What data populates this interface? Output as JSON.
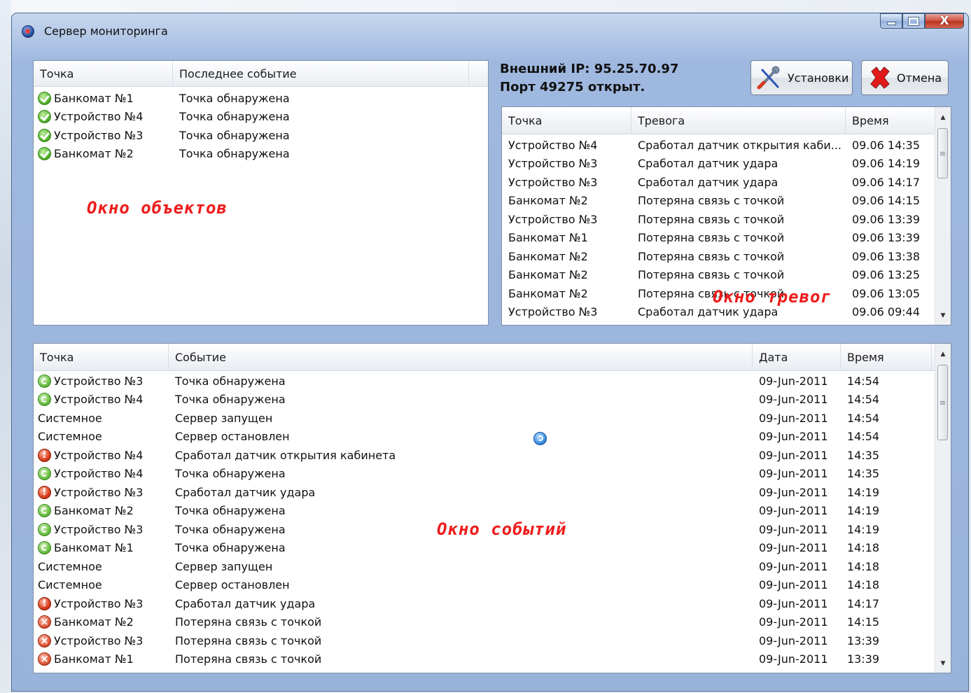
{
  "window": {
    "title": "Сервер мониторинга",
    "close_glyph": "X"
  },
  "objects": {
    "headers": [
      "Точка",
      "Последнее событие"
    ],
    "rows": [
      {
        "icon": "ok",
        "point": "Банкомат №1",
        "event": "Точка обнаружена"
      },
      {
        "icon": "ok",
        "point": "Устройство №4",
        "event": "Точка обнаружена"
      },
      {
        "icon": "ok",
        "point": "Устройство №3",
        "event": "Точка обнаружена"
      },
      {
        "icon": "ok",
        "point": "Банкомат №2",
        "event": "Точка обнаружена"
      }
    ],
    "overlay": "Окно объектов"
  },
  "status": {
    "ip_line": "Внешний IP: 95.25.70.97",
    "port_line": "Порт 49275 открыт."
  },
  "buttons": {
    "settings": "Установки",
    "cancel": "Отмена"
  },
  "alarms": {
    "headers": [
      "Точка",
      "Тревога",
      "Время"
    ],
    "rows": [
      {
        "point": "Устройство №4",
        "alarm": "Сработал датчик открытия каби...",
        "time": "09.06 14:35"
      },
      {
        "point": "Устройство №3",
        "alarm": "Сработал датчик удара",
        "time": "09.06 14:19"
      },
      {
        "point": "Устройство №3",
        "alarm": "Сработал датчик удара",
        "time": "09.06 14:17"
      },
      {
        "point": "Банкомат №2",
        "alarm": "Потеряна связь с точкой",
        "time": "09.06 14:15"
      },
      {
        "point": "Устройство №3",
        "alarm": "Потеряна связь с точкой",
        "time": "09.06 13:39"
      },
      {
        "point": "Банкомат №1",
        "alarm": "Потеряна связь с точкой",
        "time": "09.06 13:39"
      },
      {
        "point": "Банкомат №2",
        "alarm": "Потеряна связь с точкой",
        "time": "09.06 13:38"
      },
      {
        "point": "Банкомат №2",
        "alarm": "Потеряна связь с точкой",
        "time": "09.06 13:25"
      },
      {
        "point": "Банкомат №2",
        "alarm": "Потеряна связь с точкой",
        "time": "09.06 13:05"
      },
      {
        "point": "Устройство №3",
        "alarm": "Сработал датчик удара",
        "time": "09.06 09:44"
      }
    ],
    "overlay": "Окно тревог"
  },
  "events": {
    "headers": [
      "Точка",
      "Событие",
      "Дата",
      "Время"
    ],
    "rows": [
      {
        "icon": "found",
        "point": "Устройство №3",
        "event": "Точка обнаружена",
        "date": "09-Jun-2011",
        "time": "14:54"
      },
      {
        "icon": "found",
        "point": "Устройство №4",
        "event": "Точка обнаружена",
        "date": "09-Jun-2011",
        "time": "14:54"
      },
      {
        "icon": "info",
        "point": "Системное",
        "event": "Сервер запущен",
        "date": "09-Jun-2011",
        "time": "14:54"
      },
      {
        "icon": "info",
        "point": "Системное",
        "event": "Сервер остановлен",
        "date": "09-Jun-2011",
        "time": "14:54"
      },
      {
        "icon": "alarm",
        "point": "Устройство №4",
        "event": "Сработал датчик открытия кабинета",
        "date": "09-Jun-2011",
        "time": "14:35"
      },
      {
        "icon": "found",
        "point": "Устройство №4",
        "event": "Точка обнаружена",
        "date": "09-Jun-2011",
        "time": "14:35"
      },
      {
        "icon": "alarm",
        "point": "Устройство №3",
        "event": "Сработал датчик удара",
        "date": "09-Jun-2011",
        "time": "14:19"
      },
      {
        "icon": "found",
        "point": "Банкомат №2",
        "event": "Точка обнаружена",
        "date": "09-Jun-2011",
        "time": "14:19"
      },
      {
        "icon": "found",
        "point": "Устройство №3",
        "event": "Точка обнаружена",
        "date": "09-Jun-2011",
        "time": "14:19"
      },
      {
        "icon": "found",
        "point": "Банкомат №1",
        "event": "Точка обнаружена",
        "date": "09-Jun-2011",
        "time": "14:18"
      },
      {
        "icon": "info",
        "point": "Системное",
        "event": "Сервер запущен",
        "date": "09-Jun-2011",
        "time": "14:18"
      },
      {
        "icon": "info",
        "point": "Системное",
        "event": "Сервер остановлен",
        "date": "09-Jun-2011",
        "time": "14:18"
      },
      {
        "icon": "alarm",
        "point": "Устройство №3",
        "event": "Сработал датчик удара",
        "date": "09-Jun-2011",
        "time": "14:17"
      },
      {
        "icon": "lost",
        "point": "Банкомат №2",
        "event": "Потеряна связь с точкой",
        "date": "09-Jun-2011",
        "time": "14:15"
      },
      {
        "icon": "lost",
        "point": "Устройство №3",
        "event": "Потеряна связь с точкой",
        "date": "09-Jun-2011",
        "time": "13:39"
      },
      {
        "icon": "lost",
        "point": "Банкомат №1",
        "event": "Потеряна связь с точкой",
        "date": "09-Jun-2011",
        "time": "13:39"
      }
    ],
    "overlay": "Окно событий"
  }
}
